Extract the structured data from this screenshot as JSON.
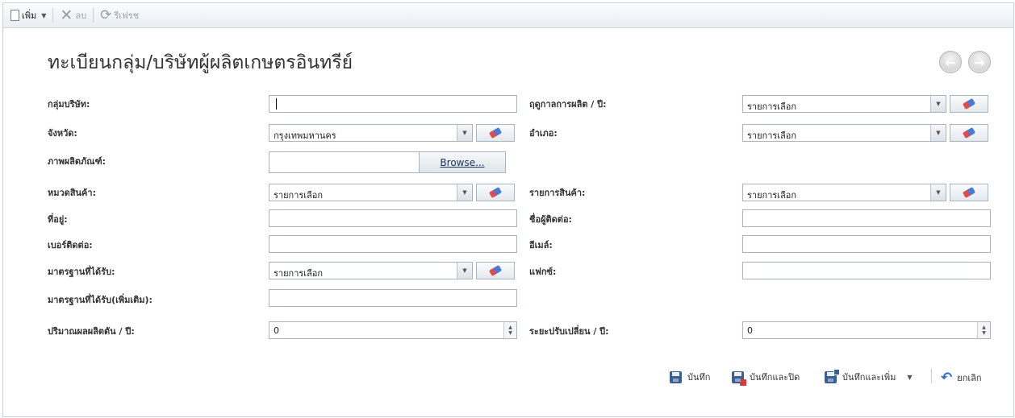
{
  "toolbar": {
    "add_label": "เพิ่ม",
    "delete_label": "ลบ",
    "refresh_label": "รีเฟรช"
  },
  "page": {
    "title": "ทะเบียนกลุ่ม/บริษัทผู้ผลิตเกษตรอินทรีย์"
  },
  "form": {
    "group_company": {
      "label": "กลุ่มบริษัท:",
      "value": ""
    },
    "production_season": {
      "label": "ฤดูกาลการผลิต / ปี:",
      "value": "รายการเลือก"
    },
    "province": {
      "label": "จังหวัด:",
      "value": "กรุงเทพมหานคร"
    },
    "district": {
      "label": "อำเภอ:",
      "value": "รายการเลือก"
    },
    "product_image": {
      "label": "ภาพผลิตภัณฑ์:",
      "value": "",
      "browse_label": "Browse..."
    },
    "product_category": {
      "label": "หมวดสินค้า:",
      "value": "รายการเลือก"
    },
    "product_item": {
      "label": "รายการสินค้า:",
      "value": "รายการเลือก"
    },
    "address": {
      "label": "ที่อยู่:",
      "value": ""
    },
    "contact_name": {
      "label": "ชื่อผู้ติดต่อ:",
      "value": ""
    },
    "phone": {
      "label": "เบอร์ติดต่อ:",
      "value": ""
    },
    "email": {
      "label": "อีเมล์:",
      "value": ""
    },
    "standard": {
      "label": "มาตรฐานที่ได้รับ:",
      "value": "รายการเลือก"
    },
    "fax": {
      "label": "แฟกซ์:",
      "value": ""
    },
    "standard_extra": {
      "label": "มาตรฐานที่ได้รับ(เพิ่มเติม):",
      "value": ""
    },
    "yield_per_year": {
      "label": "ปริมาณผลผลิตตัน / ปี:",
      "value": "0"
    },
    "conversion_period": {
      "label": "ระยะปรับเปลี่ยน / ปี:",
      "value": "0"
    }
  },
  "actions": {
    "save_label": "บันทึก",
    "save_close_label": "บันทึกและปิด",
    "save_add_label": "บันทึกและเพิ่ม",
    "cancel_label": "ยกเลิก"
  },
  "colors": {
    "border": "#a8b4c0",
    "toolbar_bg": "#e9eef3",
    "disabled_text": "#9aa4ae",
    "save_icon": "#3c5f92",
    "undo_icon": "#2c6fd1"
  }
}
